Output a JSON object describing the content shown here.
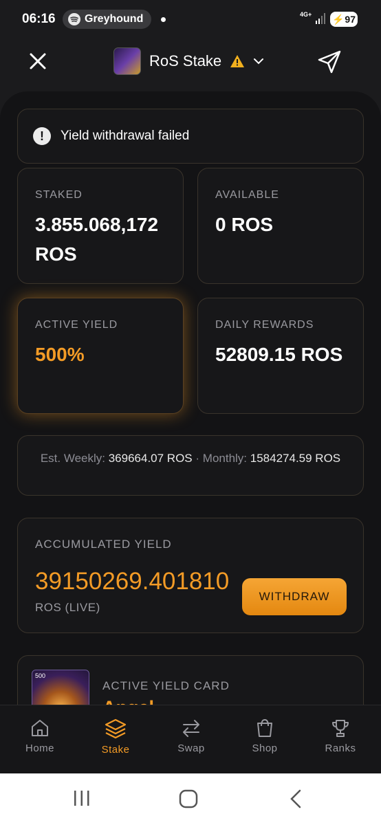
{
  "status_bar": {
    "time": "06:16",
    "media_app": "Greyhound",
    "network": "4G+",
    "battery": "97"
  },
  "header": {
    "app_name": "RoS Stake",
    "close_icon": "close-icon",
    "share_icon": "send-icon",
    "warning_icon": "warning-icon",
    "dropdown_icon": "chevron-down-icon"
  },
  "alert": {
    "message": "Yield withdrawal failed",
    "icon": "exclamation-icon"
  },
  "stats": {
    "staked_label": "STAKED",
    "staked_value": "3.855.068,172 ROS",
    "available_label": "AVAILABLE",
    "available_value": "0 ROS",
    "active_yield_label": "ACTIVE YIELD",
    "active_yield_value": "500%",
    "daily_rewards_label": "DAILY REWARDS",
    "daily_rewards_value": "52809.15 ROS"
  },
  "estimate": {
    "weekly_label": "Est. Weekly:",
    "weekly_value": "369664.07 ROS",
    "separator": "·",
    "monthly_label": "Monthly:",
    "monthly_value": "1584274.59 ROS"
  },
  "accumulated": {
    "label": "ACCUMULATED YIELD",
    "value": "39150269.401810",
    "unit": "ROS (LIVE)",
    "withdraw_label": "WITHDRAW"
  },
  "yield_card": {
    "label": "ACTIVE YIELD CARD",
    "name": "Angel",
    "thumb_number": "500"
  },
  "bottom_nav": {
    "items": [
      {
        "label": "Home",
        "icon": "home-icon"
      },
      {
        "label": "Stake",
        "icon": "layers-icon"
      },
      {
        "label": "Swap",
        "icon": "swap-arrows-icon"
      },
      {
        "label": "Shop",
        "icon": "shopping-bag-icon"
      },
      {
        "label": "Ranks",
        "icon": "trophy-icon"
      }
    ],
    "active": "Stake"
  },
  "colors": {
    "accent": "#f39b26",
    "background": "#131315",
    "card_border": "#3a342b"
  }
}
